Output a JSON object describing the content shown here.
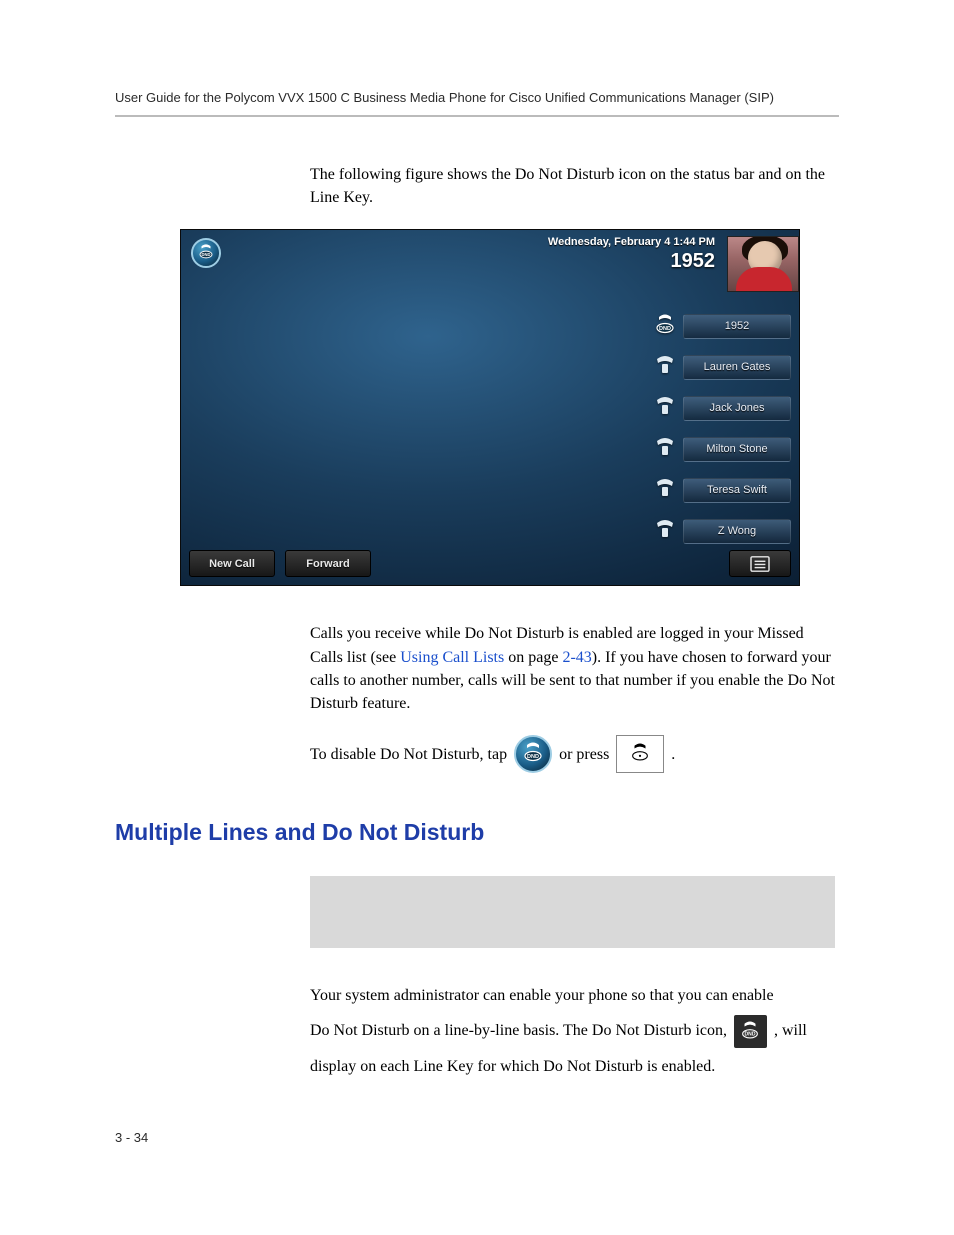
{
  "header": "User Guide for the Polycom VVX 1500 C Business Media Phone for Cisco Unified Communications Manager (SIP)",
  "intro": "The following figure shows the Do Not Disturb icon on the status bar and on the Line Key.",
  "phone": {
    "datetime": "Wednesday, February 4  1:44 PM",
    "extension": "1952",
    "linekeys": [
      {
        "label": "1952",
        "icon": "dnd"
      },
      {
        "label": "Lauren Gates",
        "icon": "phone"
      },
      {
        "label": "Jack Jones",
        "icon": "phone"
      },
      {
        "label": "Milton Stone",
        "icon": "phone"
      },
      {
        "label": "Teresa Swift",
        "icon": "phone"
      },
      {
        "label": "Z Wong",
        "icon": "phone"
      }
    ],
    "softkeys": {
      "newcall": "New Call",
      "forward": "Forward"
    }
  },
  "para2a": "Calls you receive while Do Not Disturb is enabled are logged in your Missed Calls list (see ",
  "para2link": "Using Call Lists",
  "para2b": " on page ",
  "para2pageref": "2-43",
  "para2c": "). If you have chosen to forward your calls to another number, calls will be sent to that number if you enable the Do Not Disturb feature.",
  "para3a": "To disable Do Not Disturb, tap ",
  "para3b": " or press ",
  "section_title": "Multiple Lines and Do Not Disturb",
  "para4a": "Your system administrator can enable your phone so that you can enable",
  "para4b": "Do Not Disturb on a line-by-line basis. The Do Not Disturb icon, ",
  "para4c": ", will",
  "para4d": "display on each Line Key for which Do Not Disturb is enabled.",
  "page_number": "3 - 34"
}
